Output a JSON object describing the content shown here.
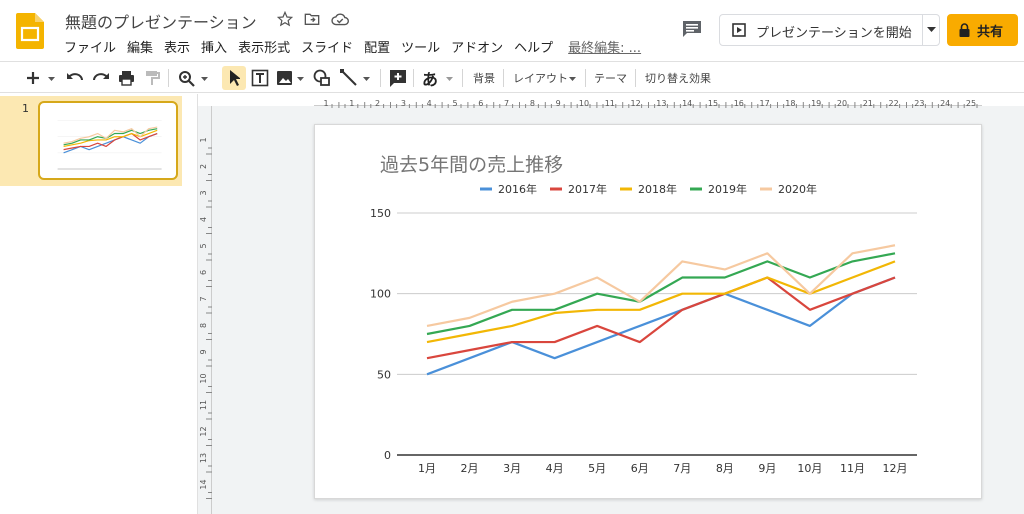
{
  "app": {
    "doc_title": "無題のプレゼンテーション"
  },
  "menu": [
    "ファイル",
    "編集",
    "表示",
    "挿入",
    "表示形式",
    "スライド",
    "配置",
    "ツール",
    "アドオン",
    "ヘルプ"
  ],
  "last_edit": "最終編集: ...",
  "present_label": "プレゼンテーションを開始",
  "share_label": "共有",
  "toolbar": {
    "background_label": "背景",
    "layout_label": "レイアウト",
    "theme_label": "テーマ",
    "transition_label": "切り替え効果",
    "font_glyph": "あ"
  },
  "filmstrip": {
    "slide_number": "1"
  },
  "ruler": {
    "h_ticks": [
      "1",
      "1",
      "2",
      "3",
      "4",
      "5",
      "6",
      "7",
      "8",
      "9",
      "10",
      "11",
      "12",
      "13",
      "14",
      "15",
      "16",
      "17",
      "18",
      "19",
      "20",
      "21",
      "22",
      "23",
      "24",
      "25"
    ],
    "v_ticks": [
      "1",
      "2",
      "3",
      "4",
      "5",
      "6",
      "7",
      "8",
      "9",
      "10",
      "11",
      "12",
      "13",
      "14"
    ]
  },
  "colors": {
    "accent": "#f9ab00",
    "selected_slide_bg": "#fce8b2"
  },
  "chart_data": {
    "type": "line",
    "title": "過去5年間の売上推移",
    "categories": [
      "1月",
      "2月",
      "3月",
      "4月",
      "5月",
      "6月",
      "7月",
      "8月",
      "9月",
      "10月",
      "11月",
      "12月"
    ],
    "ylim": [
      0,
      150
    ],
    "yticks": [
      0,
      50,
      100,
      150
    ],
    "legend_position": "top",
    "grid": true,
    "series": [
      {
        "name": "2016年",
        "color": "#4a90d9",
        "values": [
          50,
          60,
          70,
          60,
          70,
          80,
          90,
          100,
          90,
          80,
          100,
          110
        ]
      },
      {
        "name": "2017年",
        "color": "#d9463d",
        "values": [
          60,
          65,
          70,
          70,
          80,
          70,
          90,
          100,
          110,
          90,
          100,
          110
        ]
      },
      {
        "name": "2018年",
        "color": "#f2b705",
        "values": [
          70,
          75,
          80,
          88,
          90,
          90,
          100,
          100,
          110,
          100,
          110,
          120
        ]
      },
      {
        "name": "2019年",
        "color": "#34a853",
        "values": [
          75,
          80,
          90,
          90,
          100,
          95,
          110,
          110,
          120,
          110,
          120,
          125
        ]
      },
      {
        "name": "2020年",
        "color": "#f6c9a0",
        "values": [
          80,
          85,
          95,
          100,
          110,
          95,
          120,
          115,
          125,
          100,
          125,
          130
        ]
      }
    ]
  }
}
